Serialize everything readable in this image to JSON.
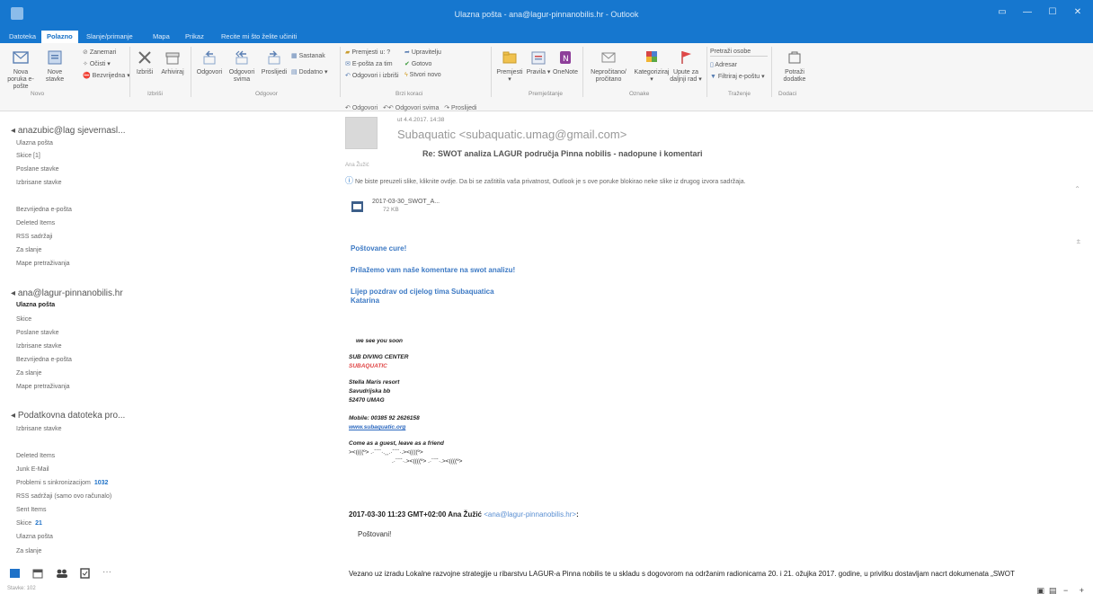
{
  "window": {
    "title": "Ulazna pošta - ana@lagur-pinnanobilis.hr - Outlook"
  },
  "ribbon_tabs": [
    "Datoteka",
    "Polazno",
    "Slanje/primanje",
    "Mapa",
    "Prikaz",
    "Recite mi što želite učiniti"
  ],
  "ribbon": {
    "new_email": "Nova poruka e-pošte",
    "new_items": "Nove stavke",
    "ignore": "Zanemari",
    "clean": "Očisti",
    "junk": "Bezvrijedna",
    "delete": "Izbriši",
    "archive": "Arhiviraj",
    "reply": "Odgovori",
    "reply_all": "Odgovori svima",
    "forward": "Proslijedi",
    "meeting": "Sastanak",
    "more": "Dodatno",
    "qs1": "Premjesti u: ?",
    "qs2": "E-pošta za tim",
    "qs3": "Odgovori i izbriši",
    "qs4": "Upravitelju",
    "qs5": "Gotovo",
    "qs6": "Stvori novo",
    "move": "Premjesti",
    "rules": "Pravila",
    "onenote": "OneNote",
    "unread": "Nepročitano/ pročitano",
    "categorize": "Kategoriziraj",
    "followup": "Upute za daljnji rad",
    "search_people": "Pretraži osobe",
    "address_book": "Adresar",
    "filter_email": "Filtriraj e-poštu",
    "get_addins": "Potraži dodatke",
    "groups": {
      "new": "Novo",
      "delete": "Izbriši",
      "respond": "Odgovor",
      "quicksteps": "Brzi koraci",
      "move": "Premještanje",
      "tags": "Oznake",
      "find": "Traženje",
      "addins": "Dodaci"
    }
  },
  "folders": {
    "account1": {
      "name": "anazubic@lag sjevernasl...",
      "items": [
        "Ulazna pošta",
        "Skice [1]",
        "Poslane stavke",
        "Izbrisane stavke",
        "",
        "Bezvrijedna e-pošta",
        "Deleted Items",
        "RSS sadržaji",
        "Za slanje",
        "Mape pretraživanja"
      ]
    },
    "account2": {
      "name": "ana@lagur-pinnanobilis.hr",
      "items": [
        "Ulazna pošta",
        "Skice",
        "Poslane stavke",
        "Izbrisane stavke",
        "Bezvrijedna e-pošta",
        "Za slanje",
        "Mape pretraživanja"
      ]
    },
    "account3": {
      "name": "Podatkovna datoteka pro...",
      "items": [
        "Izbrisane stavke",
        "",
        "Deleted Items",
        "Junk E-Mail",
        "Problemi s sinkronizacijom",
        "RSS sadržaji (samo ovo računalo)",
        "Sent Items",
        "Skice",
        "Ulazna pošta",
        "Za slanje"
      ],
      "counts": {
        "problems": "1032",
        "drafts": "21"
      }
    },
    "status": "Stavke: 102"
  },
  "message": {
    "actions": [
      "Odgovori",
      "Odgovori svima",
      "Proslijedi"
    ],
    "date": "ut 4.4.2017. 14:38",
    "sender": "Subaquatic <subaquatic.umag@gmail.com>",
    "subject": "Re: SWOT analiza LAGUR područja Pinna nobilis - nadopune i komentari",
    "recipients": "Ana Žužić",
    "warning": "Ne biste preuzeli slike, kliknite ovdje. Da bi se zaštitila vaša privatnost, Outlook je s ove poruke blokirao neke slike iz drugog izvora sadržaja.",
    "attachment_name": "2017-03-30_SWOT_A...",
    "attachment_size": "72 KB",
    "body1": "Poštovane cure!",
    "body2": "Prilažemo vam naše komentare na swot analizu!",
    "body3": "Lijep pozdrav od cijelog tima Subaquatica",
    "body4": "Katarina",
    "sig_see": "we see you soon",
    "sig_company": "SUB DIVING CENTER",
    "sig_name": "SUBAQUATIC",
    "sig_resort": "Stella Maris resort",
    "sig_street": "Savudrijska bb",
    "sig_city": "52470 UMAG",
    "sig_mobile": "Mobile: 00385 92 2626158",
    "sig_web": "www.subaquatic.org",
    "sig_motto": "Come as a guest, leave as a friend",
    "sig_fish1": "><((((º> .·´¯`·.¸¸.·´¯`·.><((((º>",
    "sig_fish2": ".·´¯`·.><((((º> .·´¯`·.><((((º>",
    "quote_header": "2017-03-30 11:23 GMT+02:00 Ana Žužić",
    "quote_link": "<ana@lagur-pinnanobilis.hr>",
    "quote_suffix": ":",
    "greeting": "Poštovani!",
    "body_line": "Vezano uz izradu Lokalne razvojne strategije u ribarstvu LAGUR-a Pinna nobilis te u skladu s dogovorom na održanim radionicama 20. i 21. ožujka 2017. godine, u privitku dostavljam nacrt dokumenata „SWOT"
  }
}
